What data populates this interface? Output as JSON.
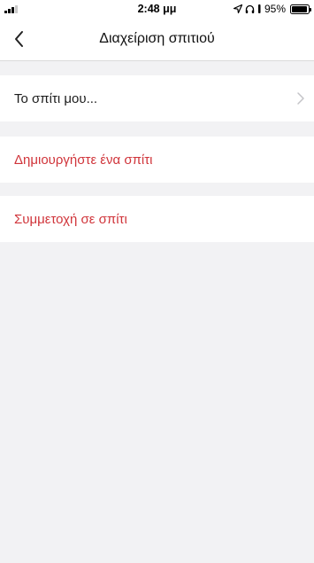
{
  "status_bar": {
    "time": "2:48 μμ",
    "battery_percent": "95%",
    "battery_level": 0.95,
    "icons": [
      "signal-icon",
      "location-icon",
      "headphones-icon",
      "battery-icon"
    ]
  },
  "nav": {
    "title": "Διαχείριση σπιτιού",
    "back_icon": "chevron-left-icon"
  },
  "rows": {
    "my_home": {
      "label": "Το σπίτι μου...",
      "icon": "chevron-right-icon"
    },
    "create_home": {
      "label": "Δημιουργήστε ένα σπίτι"
    },
    "join_home": {
      "label": "Συμμετοχή σε σπίτι"
    }
  },
  "colors": {
    "accent_red": "#d0343a",
    "background": "#f2f2f4",
    "row_background": "#ffffff"
  }
}
